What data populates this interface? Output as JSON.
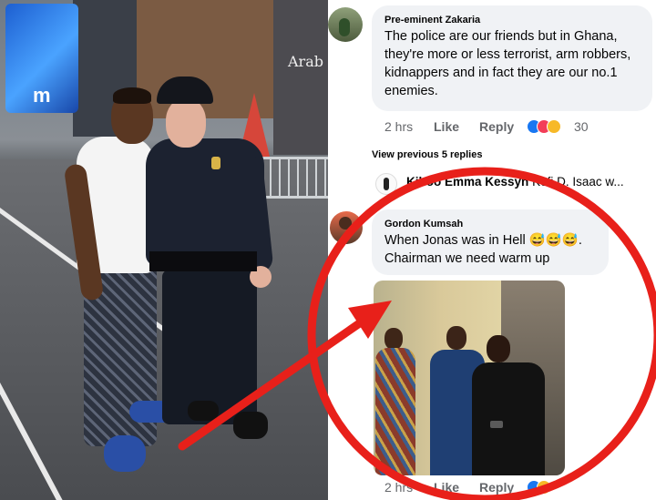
{
  "comments": [
    {
      "author": "Pre-eminent Zakaria",
      "lines": [
        "The police are our friends but in Ghana,",
        "they're more or less terrorist, arm robbers,",
        "kidnappers and in fact they are our no.1",
        "enemies."
      ],
      "time": "2 hrs",
      "like": "Like",
      "reply": "Reply",
      "reaction_count": "30",
      "reaction_icons": [
        "like-reaction-icon",
        "love-reaction-icon",
        "haha-reaction-icon"
      ]
    },
    {
      "author": "Gordon Kumsah",
      "lines": [
        "When Jonas was in Hell 😅😅😅.",
        "Chairman we need warm up"
      ],
      "time": "2 hrs",
      "like": "Like",
      "reply": "Reply",
      "reaction_icons": [
        "like-reaction-icon",
        "haha-reaction-icon"
      ]
    }
  ],
  "view_previous": "View previous 5 replies",
  "collapsed_reply": {
    "name": "Kiboo Emma Kessyn",
    "preview": "Kofi D. Isaac w..."
  },
  "photo_sign": "Arab",
  "billboard_text": "m",
  "colors": {
    "annotation_red": "#e8201a",
    "bubble_bg": "#f0f2f5",
    "meta_grey": "#65676b",
    "like_blue": "#1877f2",
    "love_red": "#f33e58",
    "haha_yellow": "#f7b928"
  }
}
